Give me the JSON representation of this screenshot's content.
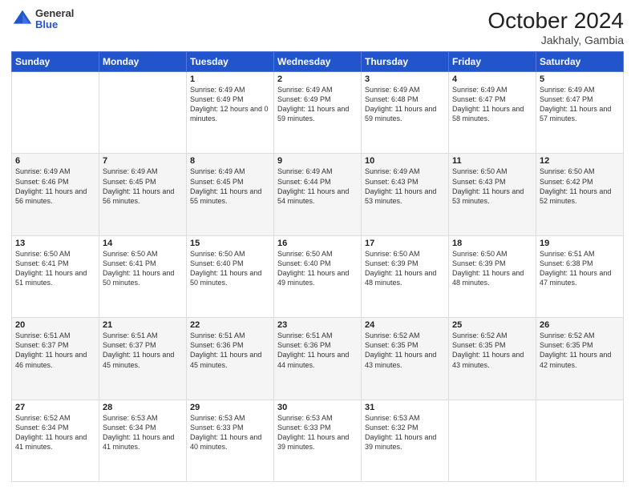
{
  "header": {
    "logo_general": "General",
    "logo_blue": "Blue",
    "month_year": "October 2024",
    "location": "Jakhaly, Gambia"
  },
  "weekdays": [
    "Sunday",
    "Monday",
    "Tuesday",
    "Wednesday",
    "Thursday",
    "Friday",
    "Saturday"
  ],
  "weeks": [
    [
      {
        "day": "",
        "detail": ""
      },
      {
        "day": "",
        "detail": ""
      },
      {
        "day": "1",
        "detail": "Sunrise: 6:49 AM\nSunset: 6:49 PM\nDaylight: 12 hours and 0 minutes."
      },
      {
        "day": "2",
        "detail": "Sunrise: 6:49 AM\nSunset: 6:49 PM\nDaylight: 11 hours and 59 minutes."
      },
      {
        "day": "3",
        "detail": "Sunrise: 6:49 AM\nSunset: 6:48 PM\nDaylight: 11 hours and 59 minutes."
      },
      {
        "day": "4",
        "detail": "Sunrise: 6:49 AM\nSunset: 6:47 PM\nDaylight: 11 hours and 58 minutes."
      },
      {
        "day": "5",
        "detail": "Sunrise: 6:49 AM\nSunset: 6:47 PM\nDaylight: 11 hours and 57 minutes."
      }
    ],
    [
      {
        "day": "6",
        "detail": "Sunrise: 6:49 AM\nSunset: 6:46 PM\nDaylight: 11 hours and 56 minutes."
      },
      {
        "day": "7",
        "detail": "Sunrise: 6:49 AM\nSunset: 6:45 PM\nDaylight: 11 hours and 56 minutes."
      },
      {
        "day": "8",
        "detail": "Sunrise: 6:49 AM\nSunset: 6:45 PM\nDaylight: 11 hours and 55 minutes."
      },
      {
        "day": "9",
        "detail": "Sunrise: 6:49 AM\nSunset: 6:44 PM\nDaylight: 11 hours and 54 minutes."
      },
      {
        "day": "10",
        "detail": "Sunrise: 6:49 AM\nSunset: 6:43 PM\nDaylight: 11 hours and 53 minutes."
      },
      {
        "day": "11",
        "detail": "Sunrise: 6:50 AM\nSunset: 6:43 PM\nDaylight: 11 hours and 53 minutes."
      },
      {
        "day": "12",
        "detail": "Sunrise: 6:50 AM\nSunset: 6:42 PM\nDaylight: 11 hours and 52 minutes."
      }
    ],
    [
      {
        "day": "13",
        "detail": "Sunrise: 6:50 AM\nSunset: 6:41 PM\nDaylight: 11 hours and 51 minutes."
      },
      {
        "day": "14",
        "detail": "Sunrise: 6:50 AM\nSunset: 6:41 PM\nDaylight: 11 hours and 50 minutes."
      },
      {
        "day": "15",
        "detail": "Sunrise: 6:50 AM\nSunset: 6:40 PM\nDaylight: 11 hours and 50 minutes."
      },
      {
        "day": "16",
        "detail": "Sunrise: 6:50 AM\nSunset: 6:40 PM\nDaylight: 11 hours and 49 minutes."
      },
      {
        "day": "17",
        "detail": "Sunrise: 6:50 AM\nSunset: 6:39 PM\nDaylight: 11 hours and 48 minutes."
      },
      {
        "day": "18",
        "detail": "Sunrise: 6:50 AM\nSunset: 6:39 PM\nDaylight: 11 hours and 48 minutes."
      },
      {
        "day": "19",
        "detail": "Sunrise: 6:51 AM\nSunset: 6:38 PM\nDaylight: 11 hours and 47 minutes."
      }
    ],
    [
      {
        "day": "20",
        "detail": "Sunrise: 6:51 AM\nSunset: 6:37 PM\nDaylight: 11 hours and 46 minutes."
      },
      {
        "day": "21",
        "detail": "Sunrise: 6:51 AM\nSunset: 6:37 PM\nDaylight: 11 hours and 45 minutes."
      },
      {
        "day": "22",
        "detail": "Sunrise: 6:51 AM\nSunset: 6:36 PM\nDaylight: 11 hours and 45 minutes."
      },
      {
        "day": "23",
        "detail": "Sunrise: 6:51 AM\nSunset: 6:36 PM\nDaylight: 11 hours and 44 minutes."
      },
      {
        "day": "24",
        "detail": "Sunrise: 6:52 AM\nSunset: 6:35 PM\nDaylight: 11 hours and 43 minutes."
      },
      {
        "day": "25",
        "detail": "Sunrise: 6:52 AM\nSunset: 6:35 PM\nDaylight: 11 hours and 43 minutes."
      },
      {
        "day": "26",
        "detail": "Sunrise: 6:52 AM\nSunset: 6:35 PM\nDaylight: 11 hours and 42 minutes."
      }
    ],
    [
      {
        "day": "27",
        "detail": "Sunrise: 6:52 AM\nSunset: 6:34 PM\nDaylight: 11 hours and 41 minutes."
      },
      {
        "day": "28",
        "detail": "Sunrise: 6:53 AM\nSunset: 6:34 PM\nDaylight: 11 hours and 41 minutes."
      },
      {
        "day": "29",
        "detail": "Sunrise: 6:53 AM\nSunset: 6:33 PM\nDaylight: 11 hours and 40 minutes."
      },
      {
        "day": "30",
        "detail": "Sunrise: 6:53 AM\nSunset: 6:33 PM\nDaylight: 11 hours and 39 minutes."
      },
      {
        "day": "31",
        "detail": "Sunrise: 6:53 AM\nSunset: 6:32 PM\nDaylight: 11 hours and 39 minutes."
      },
      {
        "day": "",
        "detail": ""
      },
      {
        "day": "",
        "detail": ""
      }
    ]
  ]
}
